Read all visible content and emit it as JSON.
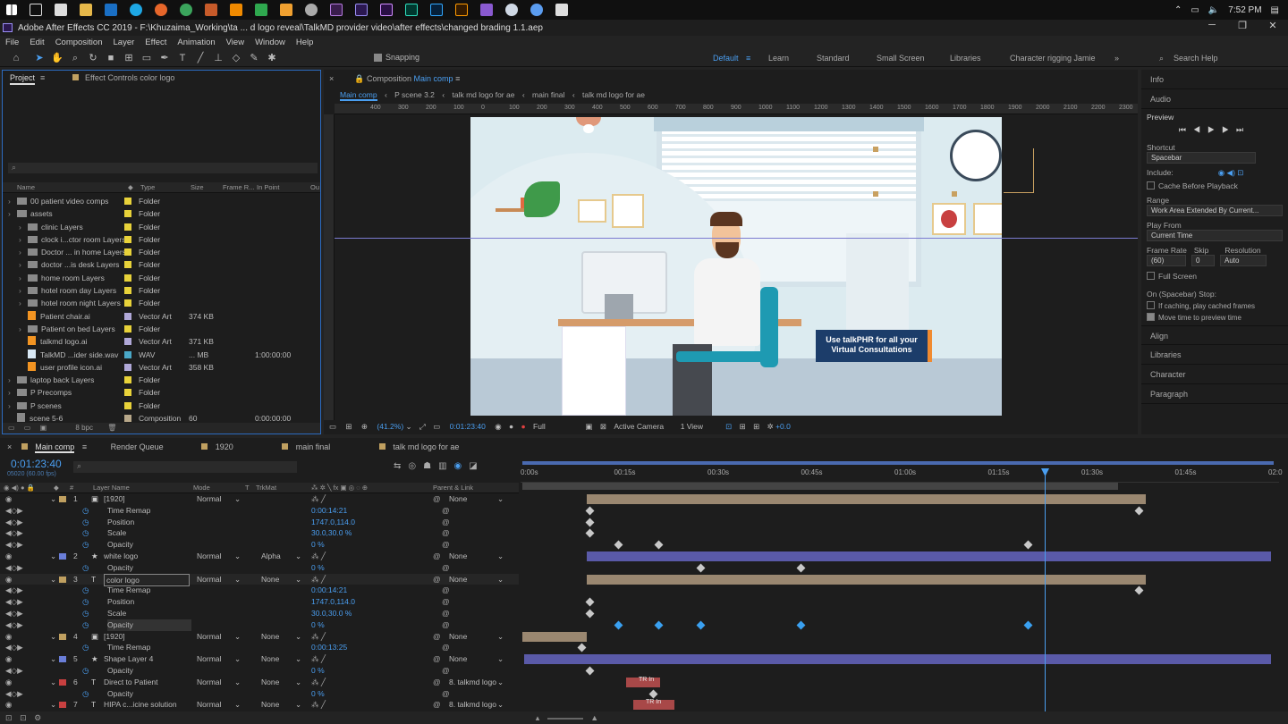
{
  "taskbar": {
    "time": "7:52 PM"
  },
  "window": {
    "title": "Adobe After Effects CC 2019 - F:\\Khuzaima_Working\\ta ... d logo reveal\\TalkMD provider video\\after effects\\changed brading 1.1.aep"
  },
  "menu": [
    "File",
    "Edit",
    "Composition",
    "Layer",
    "Effect",
    "Animation",
    "View",
    "Window",
    "Help"
  ],
  "toolbar": {
    "snapping": "Snapping",
    "workspaces": [
      "Default",
      "Learn",
      "Standard",
      "Small Screen",
      "Libraries",
      "Character rigging Jamie"
    ],
    "search": "Search Help"
  },
  "project": {
    "tabs": [
      "Project",
      "Effect Controls color logo"
    ],
    "columns": [
      "Name",
      "Type",
      "Size",
      "Frame R...",
      "In Point",
      "Ou"
    ],
    "rows": [
      {
        "name": "00 patient video comps",
        "type": "Folder",
        "size": "",
        "in": ""
      },
      {
        "name": "assets",
        "type": "Folder",
        "size": "",
        "in": ""
      },
      {
        "name": "clinic Layers",
        "type": "Folder",
        "size": "",
        "in": ""
      },
      {
        "name": "clock i...ctor room Layers",
        "type": "Folder",
        "size": "",
        "in": ""
      },
      {
        "name": "Doctor ... in home Layers",
        "type": "Folder",
        "size": "",
        "in": ""
      },
      {
        "name": "doctor ...is desk Layers",
        "type": "Folder",
        "size": "",
        "in": ""
      },
      {
        "name": "home room Layers",
        "type": "Folder",
        "size": "",
        "in": ""
      },
      {
        "name": "hotel room day Layers",
        "type": "Folder",
        "size": "",
        "in": ""
      },
      {
        "name": "hotel room night Layers",
        "type": "Folder",
        "size": "",
        "in": ""
      },
      {
        "name": "Patient chair.ai",
        "type": "Vector Art",
        "size": "374 KB",
        "in": ""
      },
      {
        "name": "Patient on bed Layers",
        "type": "Folder",
        "size": "",
        "in": ""
      },
      {
        "name": "talkmd logo.ai",
        "type": "Vector Art",
        "size": "371 KB",
        "in": ""
      },
      {
        "name": "TalkMD ...ider side.wav",
        "type": "WAV",
        "size": "... MB",
        "in": "1:00:00:00"
      },
      {
        "name": "user profile icon.ai",
        "type": "Vector Art",
        "size": "358 KB",
        "in": ""
      },
      {
        "name": "laptop back Layers",
        "type": "Folder",
        "size": "",
        "in": ""
      },
      {
        "name": "P Precomps",
        "type": "Folder",
        "size": "",
        "in": ""
      },
      {
        "name": "P scenes",
        "type": "Folder",
        "size": "",
        "in": ""
      },
      {
        "name": "scene 5-6",
        "type": "Composition",
        "size": "60",
        "in": "0:00:00:00"
      }
    ],
    "bpc": "8 bpc"
  },
  "composition": {
    "header": "Composition",
    "active": "Main comp",
    "breadcrumbs": [
      "Main comp",
      "P scene 3.2",
      "talk md logo for ae",
      "main final",
      "talk md logo for ae"
    ],
    "ruler": [
      "400",
      "300",
      "200",
      "100",
      "0",
      "100",
      "200",
      "300",
      "400",
      "500",
      "600",
      "700",
      "800",
      "900",
      "1000",
      "1100",
      "1200",
      "1300",
      "1400",
      "1500",
      "1600",
      "1700",
      "1800",
      "1900",
      "2000",
      "2100",
      "2200",
      "2300"
    ],
    "banner": [
      "Use talkPHR for all your",
      "Virtual Consultations"
    ],
    "zoom": "(41.2%)",
    "timecode": "0:01:23:40",
    "resolution": "Full",
    "camera": "Active Camera",
    "views": "1 View",
    "exposure": "+0.0"
  },
  "right": {
    "sections": [
      "Info",
      "Audio"
    ],
    "preview": "Preview",
    "shortcut_label": "Shortcut",
    "shortcut": "Spacebar",
    "include": "Include:",
    "cache": "Cache Before Playback",
    "range_label": "Range",
    "range": "Work Area Extended By Current...",
    "playfrom_label": "Play From",
    "playfrom": "Current Time",
    "fr_label": "Frame Rate",
    "skip_label": "Skip",
    "res_label": "Resolution",
    "fr": "(60)",
    "skip": "0",
    "res": "Auto",
    "fullscreen": "Full Screen",
    "stop": "On (Spacebar) Stop:",
    "stop1": "If caching, play cached frames",
    "stop2": "Move time to preview time",
    "more": [
      "Align",
      "Libraries",
      "Character",
      "Paragraph"
    ]
  },
  "timeline": {
    "tabs": [
      "Main comp",
      "Render Queue",
      "1920",
      "main final",
      "talk md logo for ae"
    ],
    "timecode": "0:01:23:40",
    "frames": "05020 (60.00 fps)",
    "cols": [
      "#",
      "Layer Name",
      "Mode",
      "T",
      "TrkMat",
      "Parent & Link"
    ],
    "ruler": [
      "0:00s",
      "00:15s",
      "00:30s",
      "00:45s",
      "01:00s",
      "01:15s",
      "01:30s",
      "01:45s",
      "02:0"
    ],
    "rows": [
      {
        "num": "1",
        "name": "[1920]",
        "mode": "Normal",
        "trk": "",
        "val": "",
        "parent": "None"
      },
      {
        "num": "",
        "name": "Time Remap",
        "mode": "",
        "trk": "",
        "val": "0:00:14:21",
        "parent": ""
      },
      {
        "num": "",
        "name": "Position",
        "mode": "",
        "trk": "",
        "val": "1747.0,114.0",
        "parent": ""
      },
      {
        "num": "",
        "name": "Scale",
        "mode": "",
        "trk": "",
        "val": "30.0,30.0 %",
        "parent": ""
      },
      {
        "num": "",
        "name": "Opacity",
        "mode": "",
        "trk": "",
        "val": "0 %",
        "parent": ""
      },
      {
        "num": "2",
        "name": "white logo",
        "mode": "Normal",
        "trk": "Alpha",
        "val": "",
        "parent": "None"
      },
      {
        "num": "",
        "name": "Opacity",
        "mode": "",
        "trk": "",
        "val": "0 %",
        "parent": ""
      },
      {
        "num": "3",
        "name": "color logo",
        "mode": "Normal",
        "trk": "None",
        "val": "",
        "parent": "None"
      },
      {
        "num": "",
        "name": "Time Remap",
        "mode": "",
        "trk": "",
        "val": "0:00:14:21",
        "parent": ""
      },
      {
        "num": "",
        "name": "Position",
        "mode": "",
        "trk": "",
        "val": "1747.0,114.0",
        "parent": ""
      },
      {
        "num": "",
        "name": "Scale",
        "mode": "",
        "trk": "",
        "val": "30.0,30.0 %",
        "parent": ""
      },
      {
        "num": "",
        "name": "Opacity",
        "mode": "",
        "trk": "",
        "val": "0 %",
        "parent": ""
      },
      {
        "num": "4",
        "name": "[1920]",
        "mode": "Normal",
        "trk": "None",
        "val": "",
        "parent": "None"
      },
      {
        "num": "",
        "name": "Time Remap",
        "mode": "",
        "trk": "",
        "val": "0:00:13:25",
        "parent": ""
      },
      {
        "num": "5",
        "name": "Shape Layer 4",
        "mode": "Normal",
        "trk": "None",
        "val": "",
        "parent": "None"
      },
      {
        "num": "",
        "name": "Opacity",
        "mode": "",
        "trk": "",
        "val": "0 %",
        "parent": ""
      },
      {
        "num": "6",
        "name": "Direct to Patient",
        "mode": "Normal",
        "trk": "None",
        "val": "",
        "parent": "8. talkmd logo"
      },
      {
        "num": "",
        "name": "Opacity",
        "mode": "",
        "trk": "",
        "val": "0 %",
        "parent": ""
      },
      {
        "num": "7",
        "name": "HIPA c...icine solution",
        "mode": "Normal",
        "trk": "None",
        "val": "",
        "parent": "8. talkmd logo"
      }
    ],
    "tr_label": "TR In"
  }
}
